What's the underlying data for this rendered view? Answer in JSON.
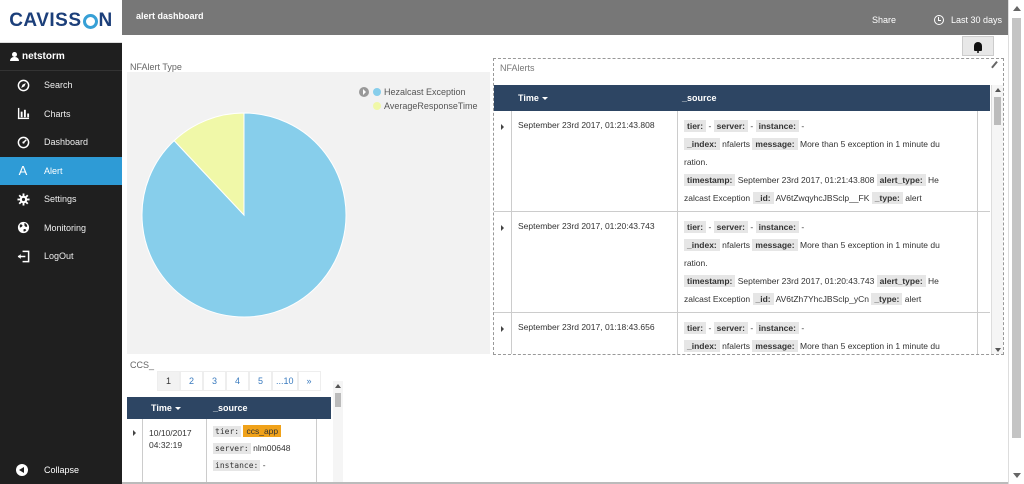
{
  "app": {
    "logo": "CAVISSON",
    "logo_left": "CAVISS",
    "logo_right": "N",
    "user": "netstorm"
  },
  "sidebar": {
    "items": [
      {
        "label": "Search",
        "icon": "compass-icon"
      },
      {
        "label": "Charts",
        "icon": "bar-chart-icon"
      },
      {
        "label": "Dashboard",
        "icon": "dashboard-icon"
      },
      {
        "label": "Alert",
        "icon": "alert-a-icon"
      },
      {
        "label": "Settings",
        "icon": "gear-icon"
      },
      {
        "label": "Monitoring",
        "icon": "globe-icon"
      },
      {
        "label": "LogOut",
        "icon": "logout-icon"
      }
    ],
    "active": "Alert",
    "collapse_label": "Collapse"
  },
  "topbar": {
    "title": "alert dashboard",
    "share": "Share",
    "time_range": "Last 30 days"
  },
  "pie_panel": {
    "title": "NFAlert Type"
  },
  "chart_data": {
    "type": "pie",
    "title": "NFAlert Type",
    "labels": [
      "Hezalcast Exception",
      "AverageResponseTime"
    ],
    "values": [
      88,
      12
    ],
    "colors": [
      "#87ceeb",
      "#f0f8a8"
    ],
    "legend": "top-right"
  },
  "nfalerts": {
    "title": "NFAlerts",
    "columns": [
      "Time",
      "_source"
    ],
    "rows": [
      {
        "time": "September 23rd 2017, 01:21:43.808",
        "tier_val": "-",
        "server_val": "-",
        "instance_val": "-",
        "index_val": "nfalerts",
        "message_val": "More than 5 exception in 1 minute du",
        "message_cont": "ration.",
        "timestamp_val": "September 23rd 2017, 01:21:43.808",
        "alert_type_val": "He",
        "alert_type_cont": "zalcast Exception",
        "id_val": "AV6tZwqyhcJBSclp__FK",
        "type_val": "alert"
      },
      {
        "time": "September 23rd 2017, 01:20:43.743",
        "tier_val": "-",
        "server_val": "-",
        "instance_val": "-",
        "index_val": "nfalerts",
        "message_val": "More than 5 exception in 1 minute du",
        "message_cont": "ration.",
        "timestamp_val": "September 23rd 2017, 01:20:43.743",
        "alert_type_val": "He",
        "alert_type_cont": "zalcast Exception",
        "id_val": "AV6tZh7YhcJBSclp_yCn",
        "type_val": "alert"
      },
      {
        "time": "September 23rd 2017, 01:18:43.656",
        "tier_val": "-",
        "server_val": "-",
        "instance_val": "-",
        "index_val": "nfalerts",
        "message_val": "More than 5 exception in 1 minute du"
      }
    ],
    "keys": {
      "tier": "tier:",
      "server": "server:",
      "instance": "instance:",
      "index": "_index:",
      "message": "message:",
      "timestamp": "timestamp:",
      "alert_type": "alert_type:",
      "id": "_id:",
      "type": "_type:"
    }
  },
  "ccs": {
    "title": "CCS_",
    "pager": [
      "1",
      "2",
      "3",
      "4",
      "5",
      "...10",
      "»"
    ],
    "current_page": "1",
    "columns": [
      "Time",
      "_source"
    ],
    "row": {
      "time_date": "10/10/2017",
      "time_clock": "04:32:19",
      "tier_key": "tier:",
      "tier_val": "ccs_app",
      "server_key": "server:",
      "server_val": "nlm00648",
      "instance_key": "instance:",
      "instance_val": "-"
    }
  }
}
